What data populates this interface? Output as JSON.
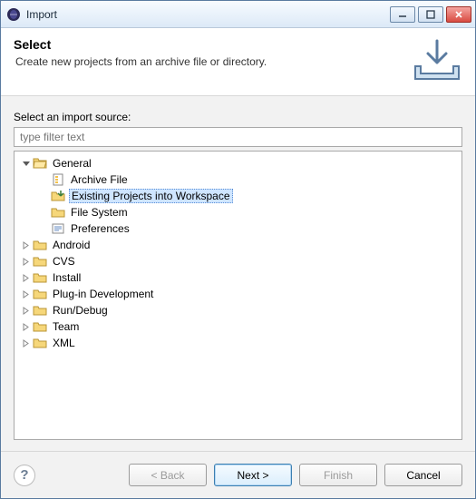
{
  "titlebar": {
    "title": "Import"
  },
  "header": {
    "heading": "Select",
    "desc": "Create new projects from an archive file or directory."
  },
  "filter": {
    "label": "Select an import source:",
    "placeholder": "type filter text"
  },
  "tree": {
    "general": {
      "label": "General",
      "archive": "Archive File",
      "existing": "Existing Projects into Workspace",
      "filesys": "File System",
      "prefs": "Preferences"
    },
    "android": "Android",
    "cvs": "CVS",
    "install": "Install",
    "plugin": "Plug-in Development",
    "rundebug": "Run/Debug",
    "team": "Team",
    "xml": "XML"
  },
  "buttons": {
    "back": "< Back",
    "next": "Next >",
    "finish": "Finish",
    "cancel": "Cancel",
    "help": "?"
  }
}
